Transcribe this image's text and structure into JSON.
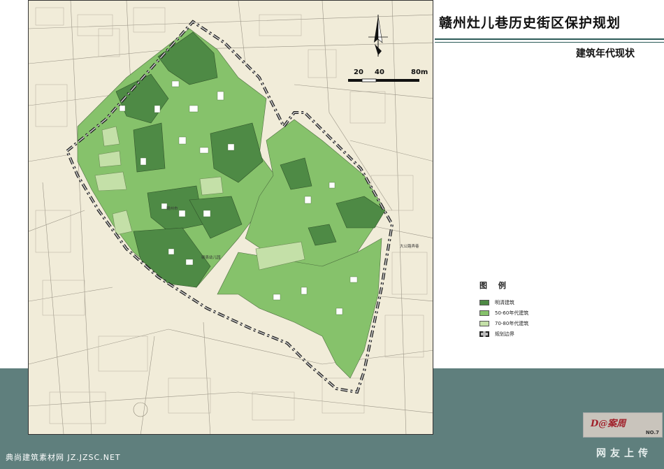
{
  "header": {
    "title": "赣州灶儿巷历史街区保护规划",
    "subtitle": "建筑年代现状"
  },
  "scale_bar": {
    "labels": [
      "20",
      "40",
      "80m"
    ]
  },
  "legend": {
    "title": "图 例",
    "items": [
      {
        "label": "明清建筑",
        "color": "#4e8a45"
      },
      {
        "label": "50-60年代建筑",
        "color": "#86c26b"
      },
      {
        "label": "70-80年代建筑",
        "color": "#c4e0a8"
      },
      {
        "label": "规划边界",
        "color": "#222222"
      }
    ]
  },
  "map_labels": {
    "kindergarten": "赣县幼儿园",
    "town_center": "赣州市",
    "lane": "大公路弄巷"
  },
  "footer": {
    "credit": "典尚建筑素材网 JZ.JZSC.NET",
    "brand": "D@案周",
    "page_no": "NO.7",
    "upload": "网友上传"
  },
  "colors": {
    "band": "#5f7f7d",
    "title_rule": "#2d5b59",
    "map_bg": "#f1ecd9"
  }
}
